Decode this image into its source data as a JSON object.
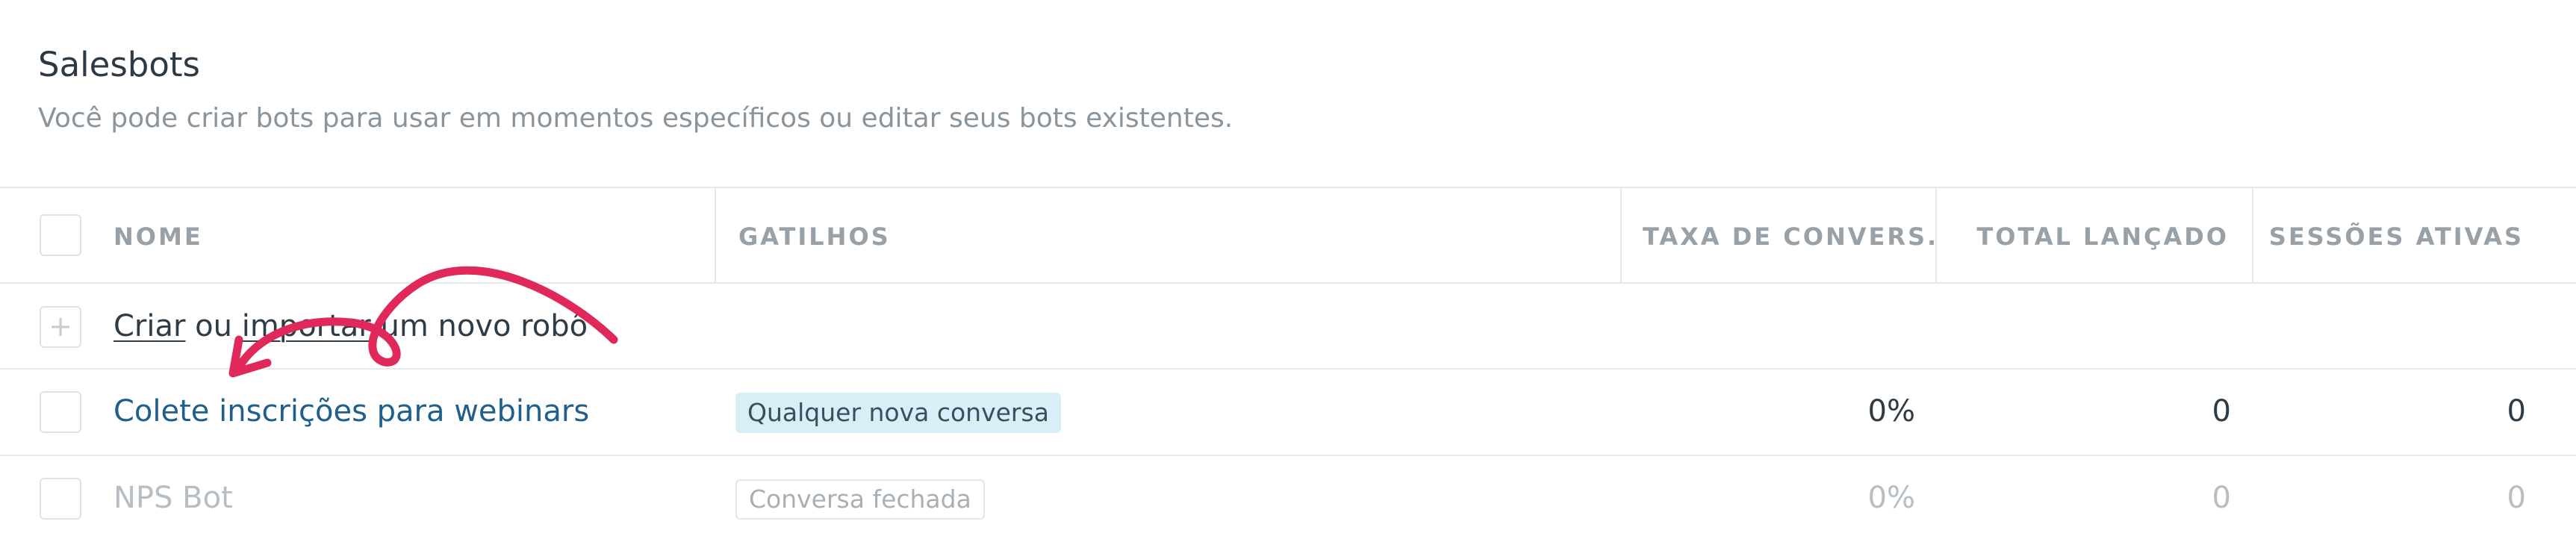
{
  "header": {
    "title": "Salesbots",
    "subtitle": "Você pode criar bots para usar em momentos específicos ou editar seus bots existentes."
  },
  "table": {
    "columns": {
      "name": "NOME",
      "triggers": "GATILHOS",
      "conversion": "TAXA DE CONVERS.",
      "total": "TOTAL LANÇADO",
      "sessions": "SESSÕES ATIVAS"
    },
    "create_row": {
      "create_link": "Criar",
      "or": " ou ",
      "import_link": "importar",
      "rest": " um novo robô"
    },
    "rows": [
      {
        "name": "Colete inscrições para webinars",
        "trigger": "Qualquer nova conversa",
        "conversion": "0%",
        "total": "0",
        "sessions": "0"
      },
      {
        "name": "NPS Bot",
        "trigger": "Conversa fechada",
        "conversion": "0%",
        "total": "0",
        "sessions": "0"
      }
    ]
  },
  "colors": {
    "active_link": "#1f5f8b",
    "inactive_text": "#b6bdc3",
    "tag_active_bg": "#d9eff8",
    "annotation": "#e0285a"
  }
}
